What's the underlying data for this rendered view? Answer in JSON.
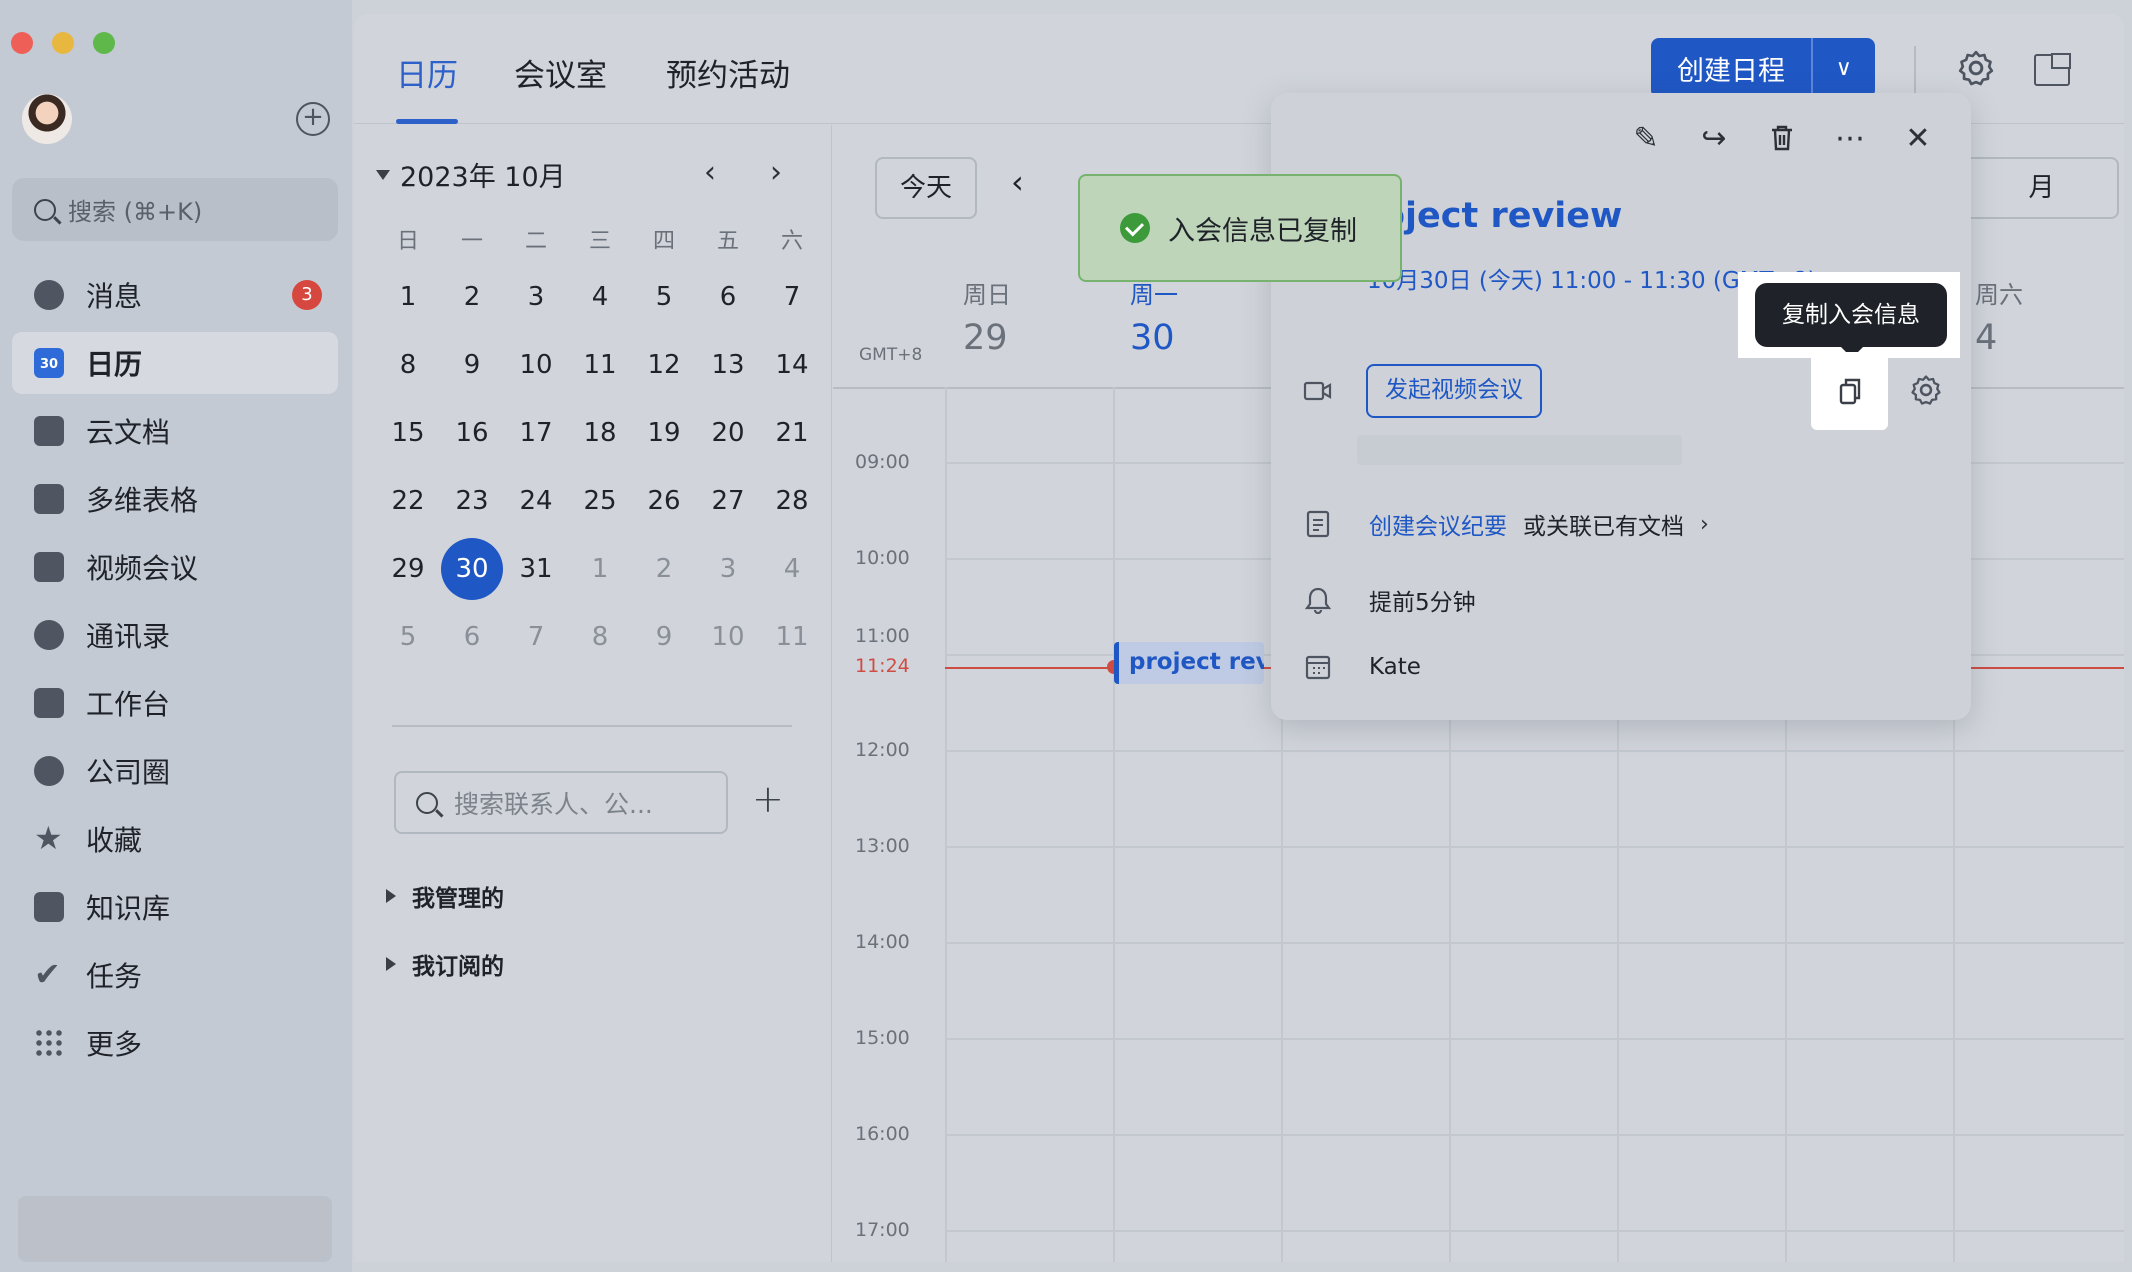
{
  "window": {
    "controls": [
      "close",
      "minimize",
      "maximize"
    ]
  },
  "sidebar": {
    "search_placeholder": "搜索 (⌘+K)",
    "items": [
      {
        "label": "消息",
        "icon": "chat-icon",
        "badge": "3"
      },
      {
        "label": "日历",
        "icon": "calendar-icon",
        "icon_text": "30",
        "active": true
      },
      {
        "label": "云文档",
        "icon": "docs-icon"
      },
      {
        "label": "多维表格",
        "icon": "base-icon"
      },
      {
        "label": "视频会议",
        "icon": "video-icon"
      },
      {
        "label": "通讯录",
        "icon": "contacts-icon"
      },
      {
        "label": "工作台",
        "icon": "workplace-icon"
      },
      {
        "label": "公司圈",
        "icon": "moments-icon"
      },
      {
        "label": "收藏",
        "icon": "star-icon"
      },
      {
        "label": "知识库",
        "icon": "wiki-icon"
      },
      {
        "label": "任务",
        "icon": "task-icon"
      },
      {
        "label": "更多",
        "icon": "more-grid-icon"
      }
    ]
  },
  "header": {
    "tabs": [
      "日历",
      "会议室",
      "预约活动"
    ],
    "active_tab": "日历",
    "create_label": "创建日程"
  },
  "mini_calendar": {
    "title": "2023年 10月",
    "weekdays": [
      "日",
      "一",
      "二",
      "三",
      "四",
      "五",
      "六"
    ],
    "weeks": [
      [
        "1",
        "2",
        "3",
        "4",
        "5",
        "6",
        "7"
      ],
      [
        "8",
        "9",
        "10",
        "11",
        "12",
        "13",
        "14"
      ],
      [
        "15",
        "16",
        "17",
        "18",
        "19",
        "20",
        "21"
      ],
      [
        "22",
        "23",
        "24",
        "25",
        "26",
        "27",
        "28"
      ],
      [
        "29",
        "30",
        "31",
        "1",
        "2",
        "3",
        "4"
      ],
      [
        "5",
        "6",
        "7",
        "8",
        "9",
        "10",
        "11"
      ]
    ],
    "selected": "30",
    "contact_search_placeholder": "搜索联系人、公...",
    "groups": [
      "我管理的",
      "我订阅的"
    ]
  },
  "week_view": {
    "today_label": "今天",
    "view_label": "月",
    "timezone": "GMT+8",
    "days": [
      {
        "weekday": "周日",
        "date": "29"
      },
      {
        "weekday": "周一",
        "date": "30",
        "today": true
      },
      {
        "weekday": "周六",
        "date": "4"
      }
    ],
    "times": [
      "09:00",
      "10:00",
      "11:00",
      "12:00",
      "13:00",
      "14:00",
      "15:00",
      "16:00",
      "17:00"
    ],
    "now": "11:24",
    "event_label": "project revi"
  },
  "event_popover": {
    "title": "oject review",
    "time": "10月30日 (今天) 11:00 - 11:30 (GMT+8)",
    "video_button": "发起视频会议",
    "notes_link": "创建会议纪要",
    "notes_alt": "或关联已有文档",
    "reminder": "提前5分钟",
    "calendar_owner": "Kate",
    "tooltip": "复制入会信息"
  },
  "toast": {
    "message": "入会信息已复制"
  },
  "colors": {
    "accent": "#1f57c5",
    "now_line": "#cf4c43",
    "toast_bg": "#bed5ba",
    "badge": "#d6483f"
  }
}
